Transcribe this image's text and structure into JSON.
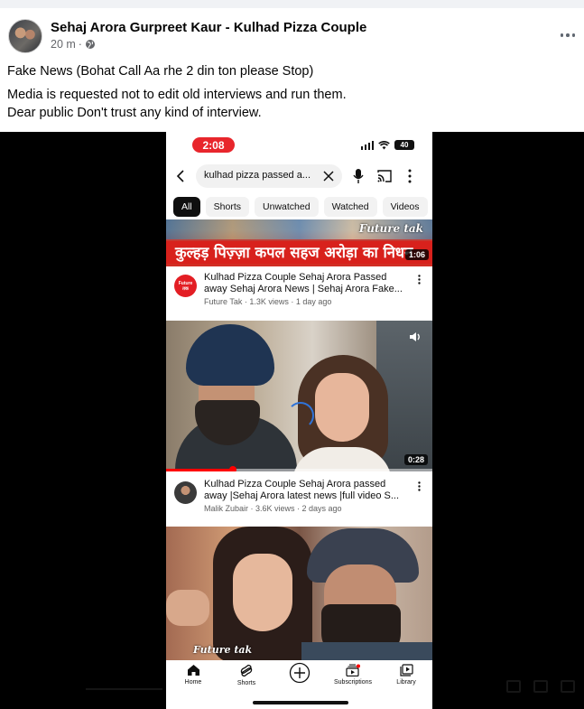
{
  "post": {
    "author": "Sehaj Arora Gurpreet Kaur - Kulhad Pizza Couple",
    "time": "20 m",
    "separator": "·",
    "lines": [
      "Fake News  (Bohat Call Aa rhe 2 din ton please Stop)",
      "Media is requested not to edit old interviews and run them.",
      "Dear public Don't trust any kind of interview."
    ]
  },
  "phone": {
    "clock": "2:08",
    "battery": "40",
    "search_query": "kulhad pizza passed a...",
    "chips": [
      "All",
      "Shorts",
      "Unwatched",
      "Watched",
      "Videos"
    ],
    "videos": [
      {
        "brand": "Future tak",
        "headline": "कुल्हड़ पिज़्ज़ा कपल सहज अरोड़ा का निधन",
        "duration": "1:06",
        "channel_badge": "Future तक",
        "title": "Kulhad Pizza Couple Sehaj Arora Passed away  Sehaj Arora News | Sehaj Arora Fake...",
        "meta": "Future Tak · 1.3K views · 1 day ago"
      },
      {
        "duration": "0:28",
        "progress": 0.25,
        "title": "Kulhad Pizza Couple Sehaj Arora passed away |Sehaj Arora latest news |full video S...",
        "meta": "Malik Zubair · 3.6K views · 2 days ago"
      },
      {
        "brand": "Future tak"
      }
    ],
    "nav": [
      "Home",
      "Shorts",
      "Subscriptions",
      "Library"
    ]
  },
  "colors": {
    "accent_red": "#ff0000",
    "headline_red": "#d8211c",
    "meta_grey": "#65676b"
  },
  "icons": [
    "globe-icon",
    "more-icon",
    "back-icon",
    "clear-icon",
    "mic-icon",
    "cast-icon",
    "kebab-icon",
    "volume-icon",
    "home-icon",
    "shorts-icon",
    "create-icon",
    "subscriptions-icon",
    "library-icon"
  ]
}
